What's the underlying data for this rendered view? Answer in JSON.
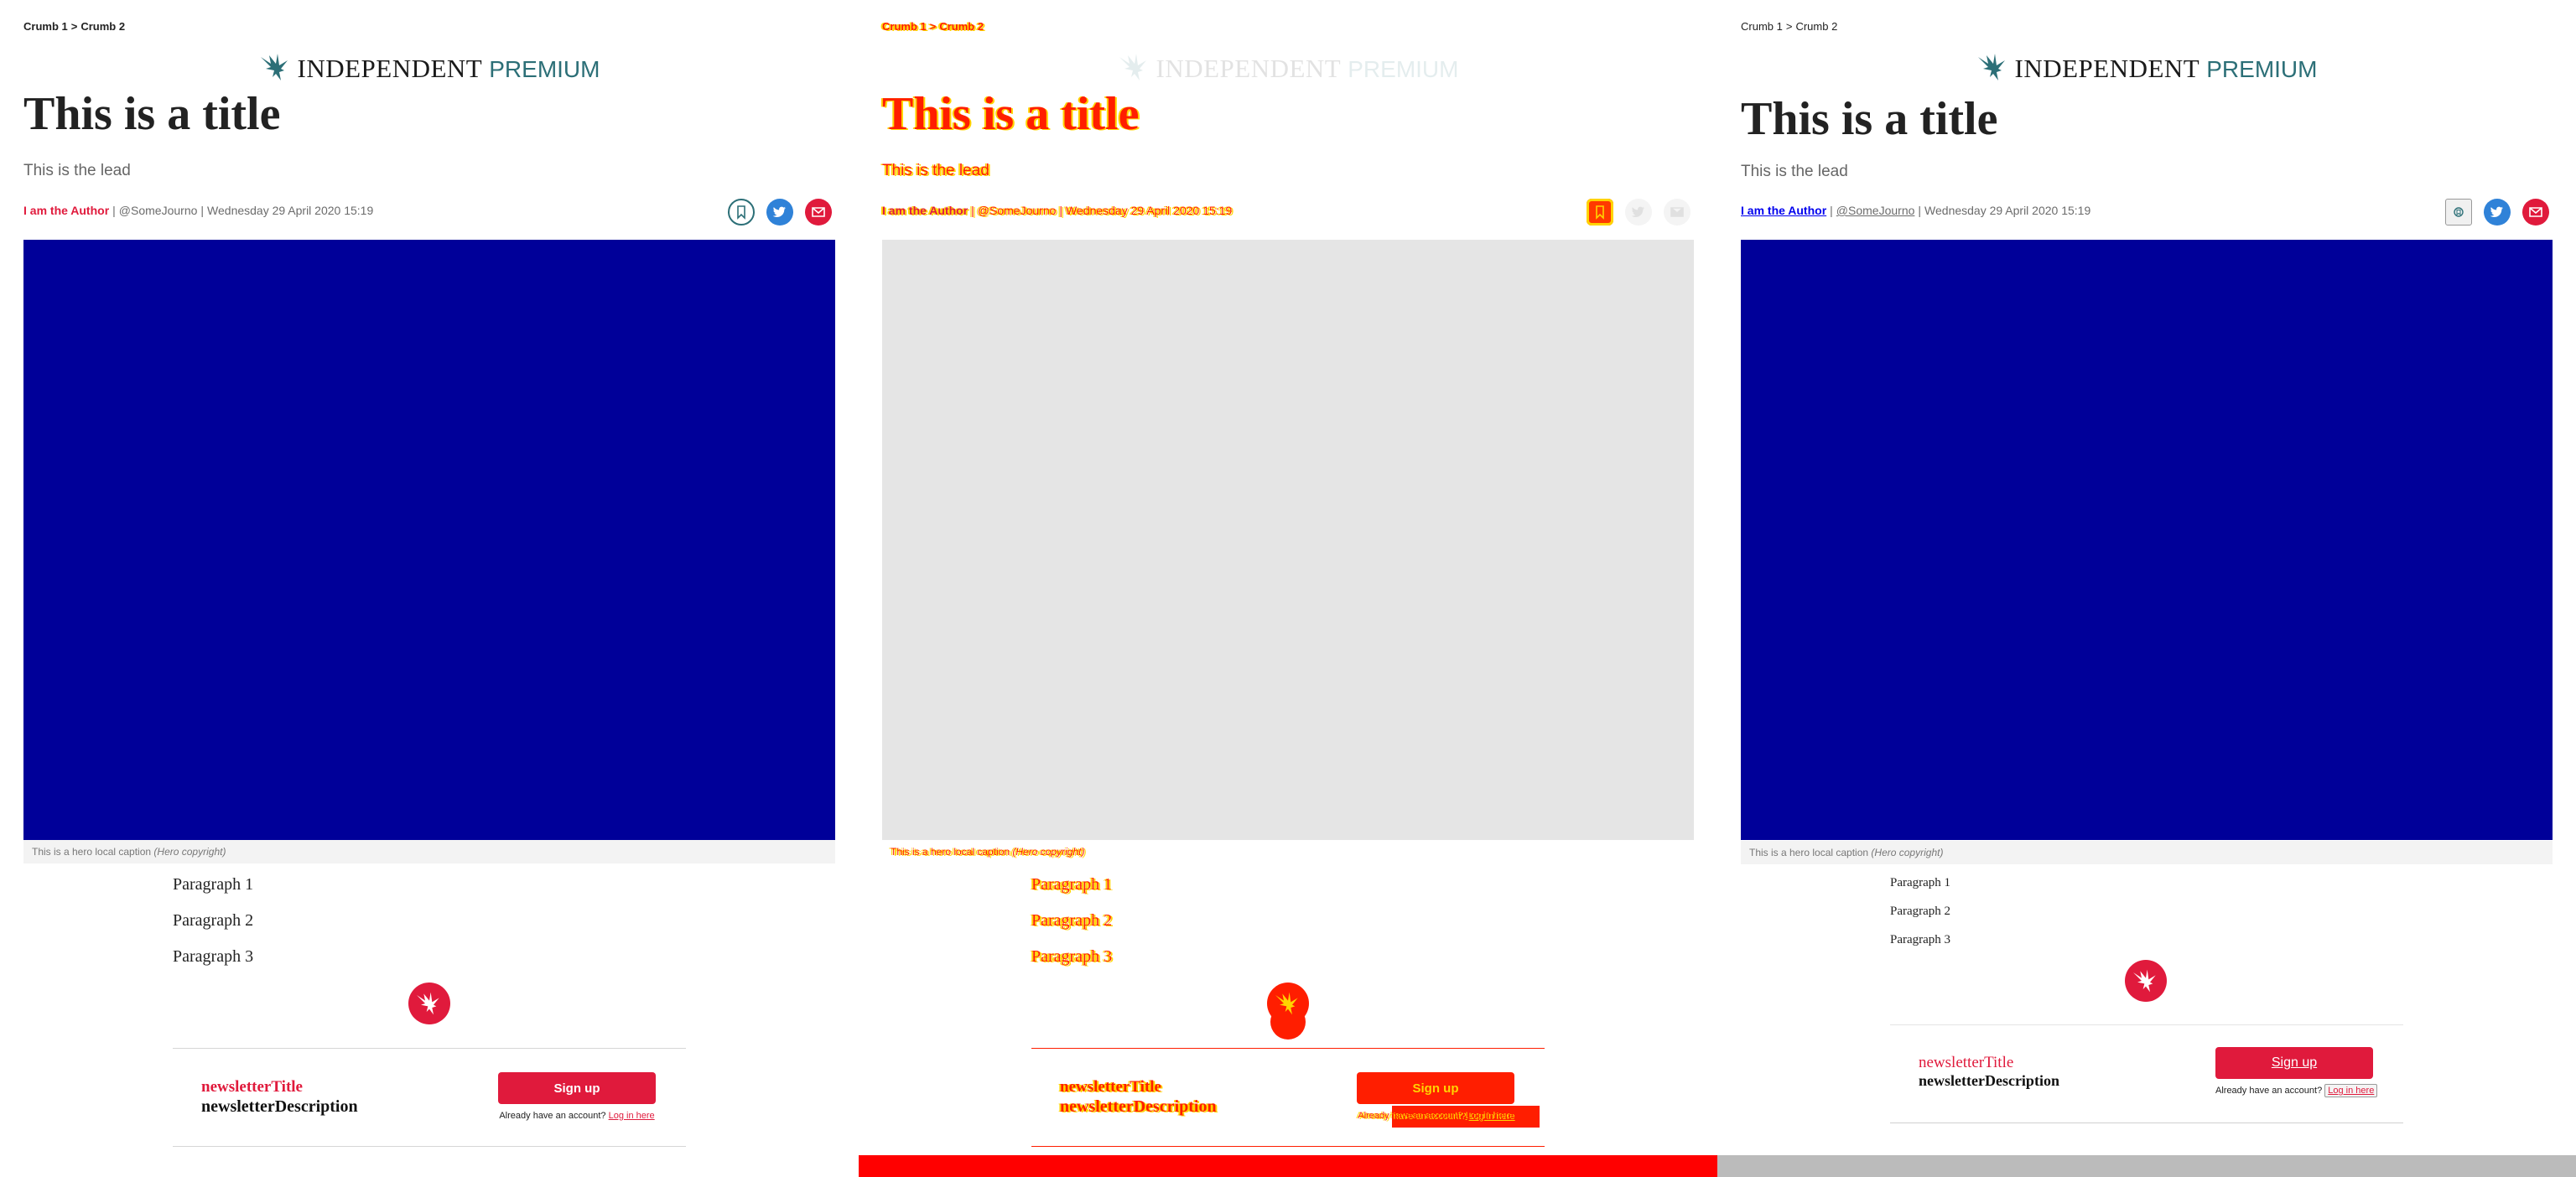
{
  "article": {
    "breadcrumbs": [
      "Crumb 1",
      "Crumb 2"
    ],
    "breadcrumb_separator": ">",
    "logo": {
      "brand": "INDEPENDENT",
      "tier": "PREMIUM"
    },
    "title": "This is a title",
    "lead": "This is the lead",
    "author": "I am the Author",
    "handle": "@SomeJourno",
    "date": "Wednesday 29 April 2020 15:19",
    "byline_separator": "|",
    "caption": {
      "text": "This is a hero local caption",
      "credit": "(Hero copyright)"
    },
    "paragraphs": [
      "Paragraph 1",
      "Paragraph 2",
      "Paragraph 3"
    ],
    "newsletter": {
      "title": "newsletterTitle",
      "description": "newsletterDescription",
      "signup_label": "Sign up",
      "account_prompt": "Already have an account?",
      "login_label": "Log in here"
    }
  },
  "icons": {
    "bookmark": "bookmark-icon",
    "twitter": "twitter-icon",
    "email": "email-icon",
    "logo": "eagle-icon"
  },
  "colors": {
    "accent": "#e01a3c",
    "brand_teal": "#2c6f77",
    "hero": "#000099",
    "twitter": "#2f82d8",
    "diff_primary": "#ff1e00",
    "diff_secondary": "#ffd400"
  }
}
